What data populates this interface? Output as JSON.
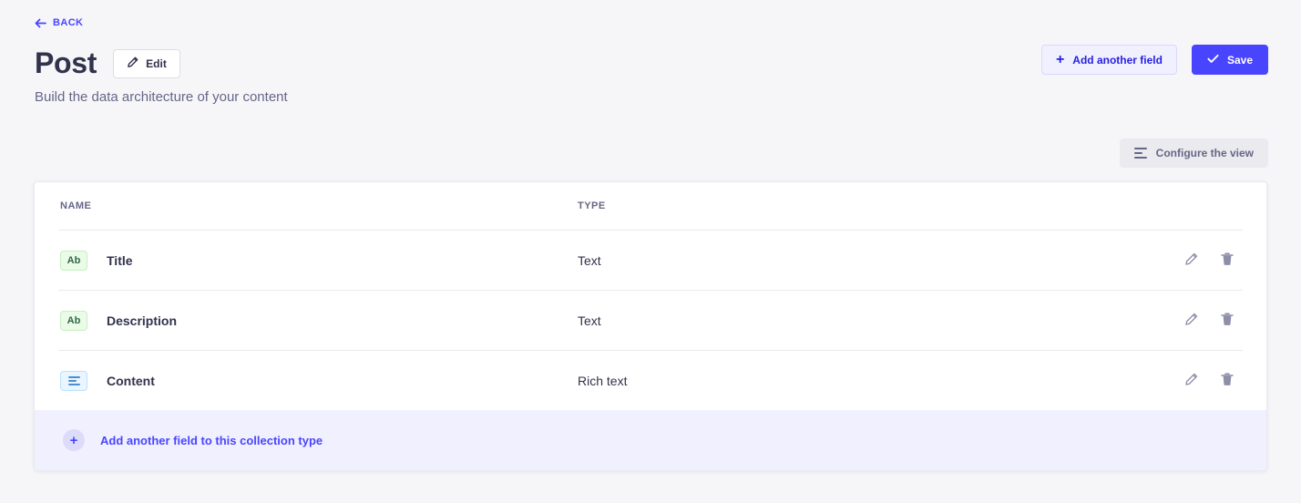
{
  "header": {
    "back_label": "BACK",
    "title": "Post",
    "edit_label": "Edit",
    "subtitle": "Build the data architecture of your content",
    "add_field_label": "Add another field",
    "save_label": "Save"
  },
  "toolbar": {
    "configure_label": "Configure the view"
  },
  "table": {
    "columns": {
      "name": "NAME",
      "type": "TYPE"
    },
    "rows": [
      {
        "badge": "Ab",
        "badge_kind": "text",
        "name": "Title",
        "type": "Text"
      },
      {
        "badge": "Ab",
        "badge_kind": "text",
        "name": "Description",
        "type": "Text"
      },
      {
        "badge": "",
        "badge_kind": "richtext",
        "name": "Content",
        "type": "Rich text"
      }
    ]
  },
  "footer": {
    "add_label": "Add another field to this collection type",
    "add_icon": "plus-icon"
  },
  "colors": {
    "accent": "#4945ff",
    "accent_soft": "#f0f0ff",
    "page_bg": "#f6f6f9",
    "text_dark": "#32324d",
    "text_muted": "#666687",
    "badge_text_bg": "#eafbe7",
    "badge_richtext_bg": "#eaf5ff"
  }
}
